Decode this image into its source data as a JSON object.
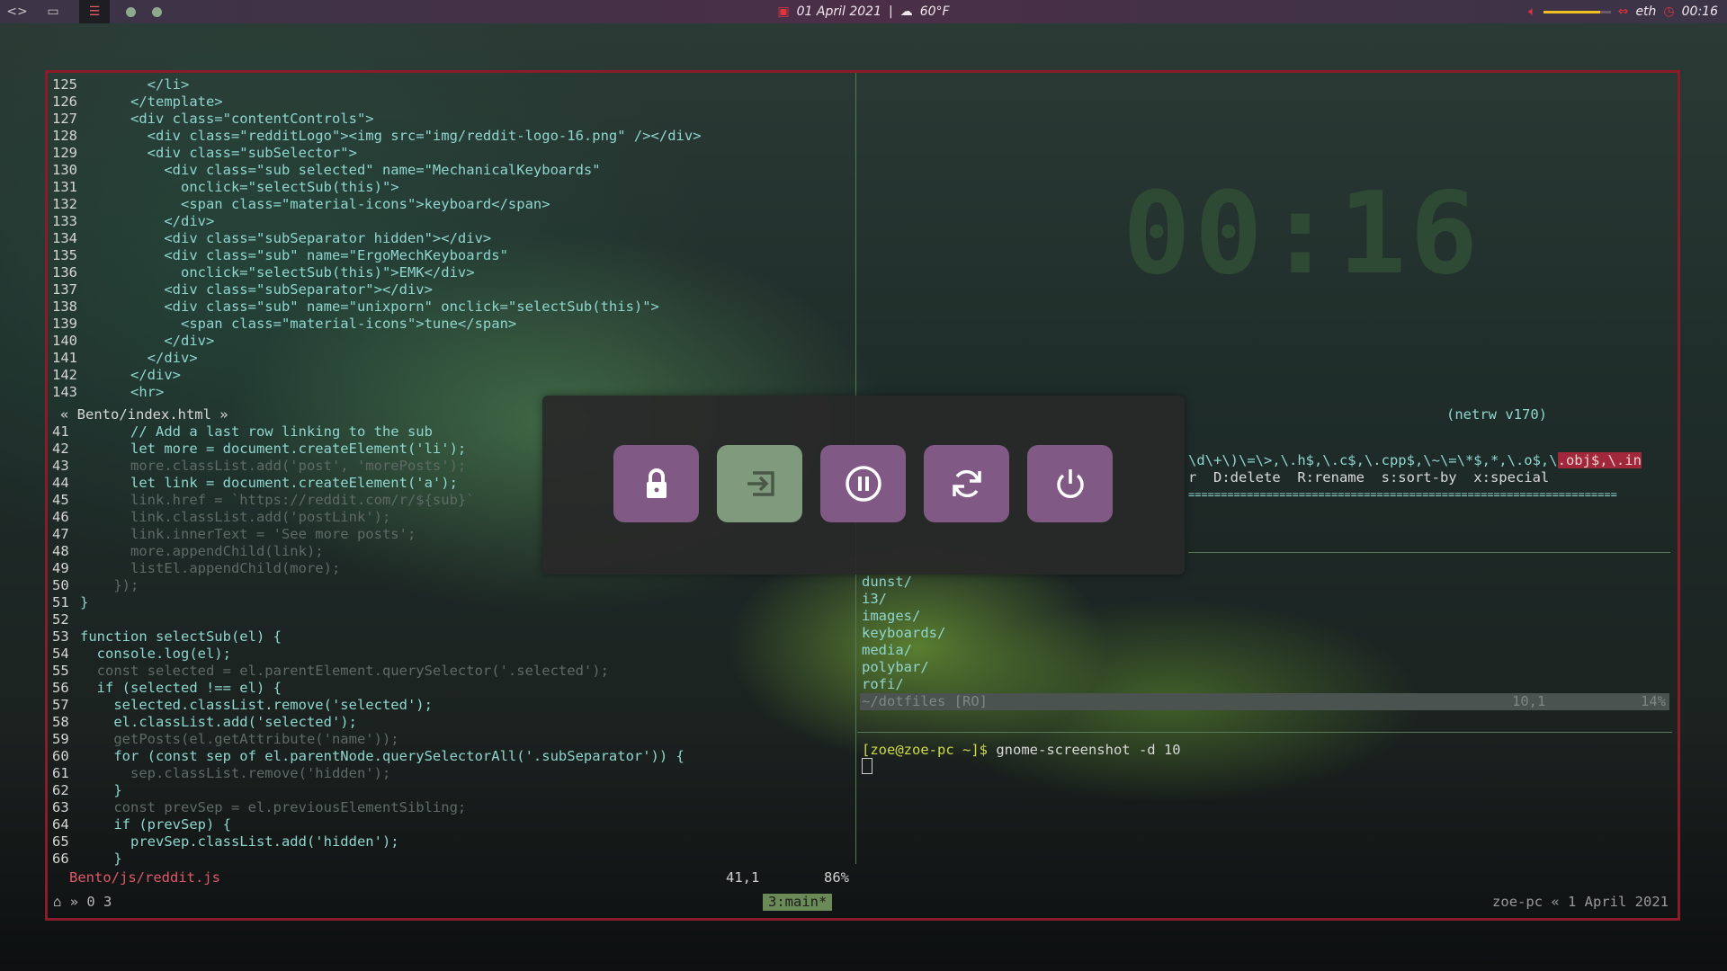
{
  "topbar": {
    "left_icons": [
      "code-icon",
      "monitor-icon",
      "settings-sliders-icon"
    ],
    "date": "01 April 2021",
    "separator": "|",
    "weather": "60°F",
    "network": "eth",
    "time": "00:16",
    "volume_level": 0.85,
    "colors": {
      "accent": "#e0333e",
      "volume": "#f0c020"
    }
  },
  "editor": {
    "top_lines": [
      {
        "n": "125",
        "t": "        </li>"
      },
      {
        "n": "126",
        "t": "      </template>"
      },
      {
        "n": "127",
        "t": "      <div class=\"contentControls\">"
      },
      {
        "n": "128",
        "t": "        <div class=\"redditLogo\"><img src=\"img/reddit-logo-16.png\" /></div>"
      },
      {
        "n": "129",
        "t": "        <div class=\"subSelector\">"
      },
      {
        "n": "130",
        "t": "          <div class=\"sub selected\" name=\"MechanicalKeyboards\""
      },
      {
        "n": "131",
        "t": "            onclick=\"selectSub(this)\">"
      },
      {
        "n": "132",
        "t": "            <span class=\"material-icons\">keyboard</span>"
      },
      {
        "n": "133",
        "t": "          </div>"
      },
      {
        "n": "134",
        "t": "          <div class=\"subSeparator hidden\"></div>"
      },
      {
        "n": "135",
        "t": "          <div class=\"sub\" name=\"ErgoMechKeyboards\""
      },
      {
        "n": "136",
        "t": "            onclick=\"selectSub(this)\">EMK</div>"
      },
      {
        "n": "137",
        "t": "          <div class=\"subSeparator\"></div>"
      },
      {
        "n": "138",
        "t": "          <div class=\"sub\" name=\"unixporn\" onclick=\"selectSub(this)\">"
      },
      {
        "n": "139",
        "t": "            <span class=\"material-icons\">tune</span>"
      },
      {
        "n": "140",
        "t": "          </div>"
      },
      {
        "n": "141",
        "t": "        </div>"
      },
      {
        "n": "142",
        "t": "      </div>"
      },
      {
        "n": "143",
        "t": "      <hr>"
      }
    ],
    "top_status": "« Bento/index.html »",
    "bottom_lines": [
      {
        "n": "41",
        "t": "      // Add a last row linking to the sub"
      },
      {
        "n": "42",
        "t": "      let more = document.createElement('li');"
      },
      {
        "n": "43",
        "t": "      more.classList.add('post', 'morePosts');"
      },
      {
        "n": "44",
        "t": "      let link = document.createElement('a');"
      },
      {
        "n": "45",
        "t": "      link.href = `https://reddit.com/r/${sub}`"
      },
      {
        "n": "46",
        "t": "      link.classList.add('postLink');"
      },
      {
        "n": "47",
        "t": "      link.innerText = 'See more posts';"
      },
      {
        "n": "48",
        "t": "      more.appendChild(link);"
      },
      {
        "n": "49",
        "t": "      listEl.appendChild(more);"
      },
      {
        "n": "50",
        "t": "    });"
      },
      {
        "n": "51",
        "t": "}"
      },
      {
        "n": "52",
        "t": ""
      },
      {
        "n": "53",
        "t": "function selectSub(el) {"
      },
      {
        "n": "54",
        "t": "  console.log(el);"
      },
      {
        "n": "55",
        "t": "  const selected = el.parentElement.querySelector('.selected');"
      },
      {
        "n": "56",
        "t": "  if (selected !== el) {"
      },
      {
        "n": "57",
        "t": "    selected.classList.remove('selected');"
      },
      {
        "n": "58",
        "t": "    el.classList.add('selected');"
      },
      {
        "n": "59",
        "t": "    getPosts(el.getAttribute('name'));"
      },
      {
        "n": "60",
        "t": "    for (const sep of el.parentNode.querySelectorAll('.subSeparator')) {"
      },
      {
        "n": "61",
        "t": "      sep.classList.remove('hidden');"
      },
      {
        "n": "62",
        "t": "    }"
      },
      {
        "n": "63",
        "t": "    const prevSep = el.previousElementSibling;"
      },
      {
        "n": "64",
        "t": "    if (prevSep) {"
      },
      {
        "n": "65",
        "t": "      prevSep.classList.add('hidden');"
      },
      {
        "n": "66",
        "t": "    }"
      }
    ],
    "bottom_status_file": "Bento/js/reddit.js",
    "bottom_status_pos": "41,1",
    "bottom_status_pct": "86%"
  },
  "clock": {
    "text": "00:16"
  },
  "netrw": {
    "version": "(netrw v170)",
    "sort_seq": "\\d\\+\\)\\=\\>,\\.h$,\\.c$,\\.cpp$,\\~\\=\\*$,*,\\.o$,\\",
    "sort_seq_hl": ".obj$,\\.in",
    "help_line": "r  D:delete  R:rename  s:sort-by  x:special",
    "rule": "==================================================================",
    "entries": [
      "dunst/",
      "i3/",
      "images/",
      "keyboards/",
      "media/",
      "polybar/",
      "rofi/"
    ],
    "status_path": "~/dotfiles [RO]",
    "status_pos": "10,1",
    "status_pct": "14%"
  },
  "terminal": {
    "prompt": "[zoe@zoe-pc ~]$",
    "command": "gnome-screenshot -d 10"
  },
  "tmux": {
    "left": "» 0 3",
    "window": "3:main*",
    "right": "zoe-pc «  1 April 2021"
  },
  "powermenu": {
    "buttons": [
      {
        "name": "lock",
        "icon": "lock-icon"
      },
      {
        "name": "logout",
        "icon": "logout-icon"
      },
      {
        "name": "suspend",
        "icon": "pause-icon"
      },
      {
        "name": "reboot",
        "icon": "reboot-icon"
      },
      {
        "name": "shutdown",
        "icon": "power-icon"
      }
    ],
    "active_index": 1,
    "colors": {
      "button": "#805a85",
      "active": "#7f9a7d"
    }
  }
}
